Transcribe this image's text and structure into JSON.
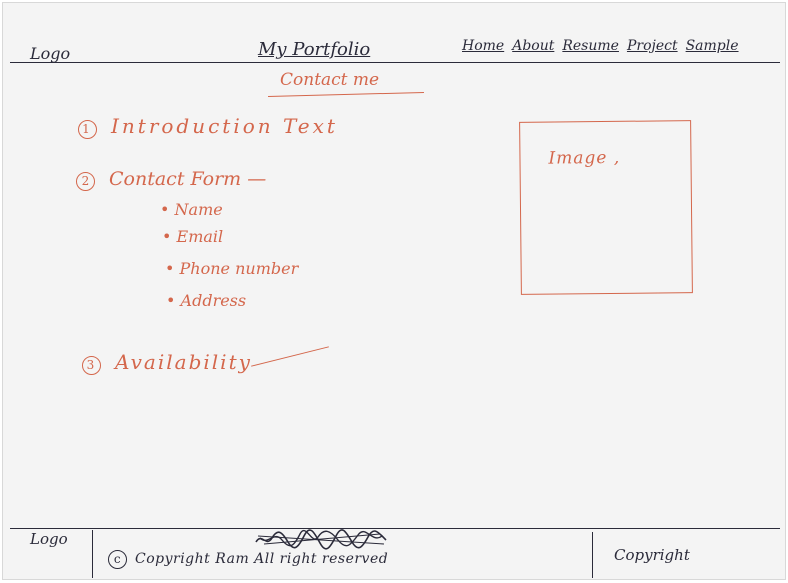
{
  "header": {
    "logo": "Logo",
    "title": "My Portfolio",
    "nav": [
      "Home",
      "About",
      "Resume",
      "Project",
      "Sample"
    ],
    "subtitle": "Contact me"
  },
  "content": {
    "item1": {
      "num": "1",
      "label": "Introduction Text"
    },
    "item2": {
      "num": "2",
      "label": "Contact Form —",
      "fields": [
        "• Name",
        "• Email",
        "• Phone number",
        "• Address"
      ]
    },
    "item3": {
      "num": "3",
      "label": "Availability"
    }
  },
  "image_box": {
    "label": "Image ,"
  },
  "footer": {
    "logo": "Logo",
    "copyright_symbol": "c",
    "copyright_text": "Copyright Ram All right reserved",
    "copyright_right": "Copyright"
  },
  "colors": {
    "ink": "#2b2b3a",
    "accent": "#d4674c",
    "paper": "#f4f4f4"
  }
}
